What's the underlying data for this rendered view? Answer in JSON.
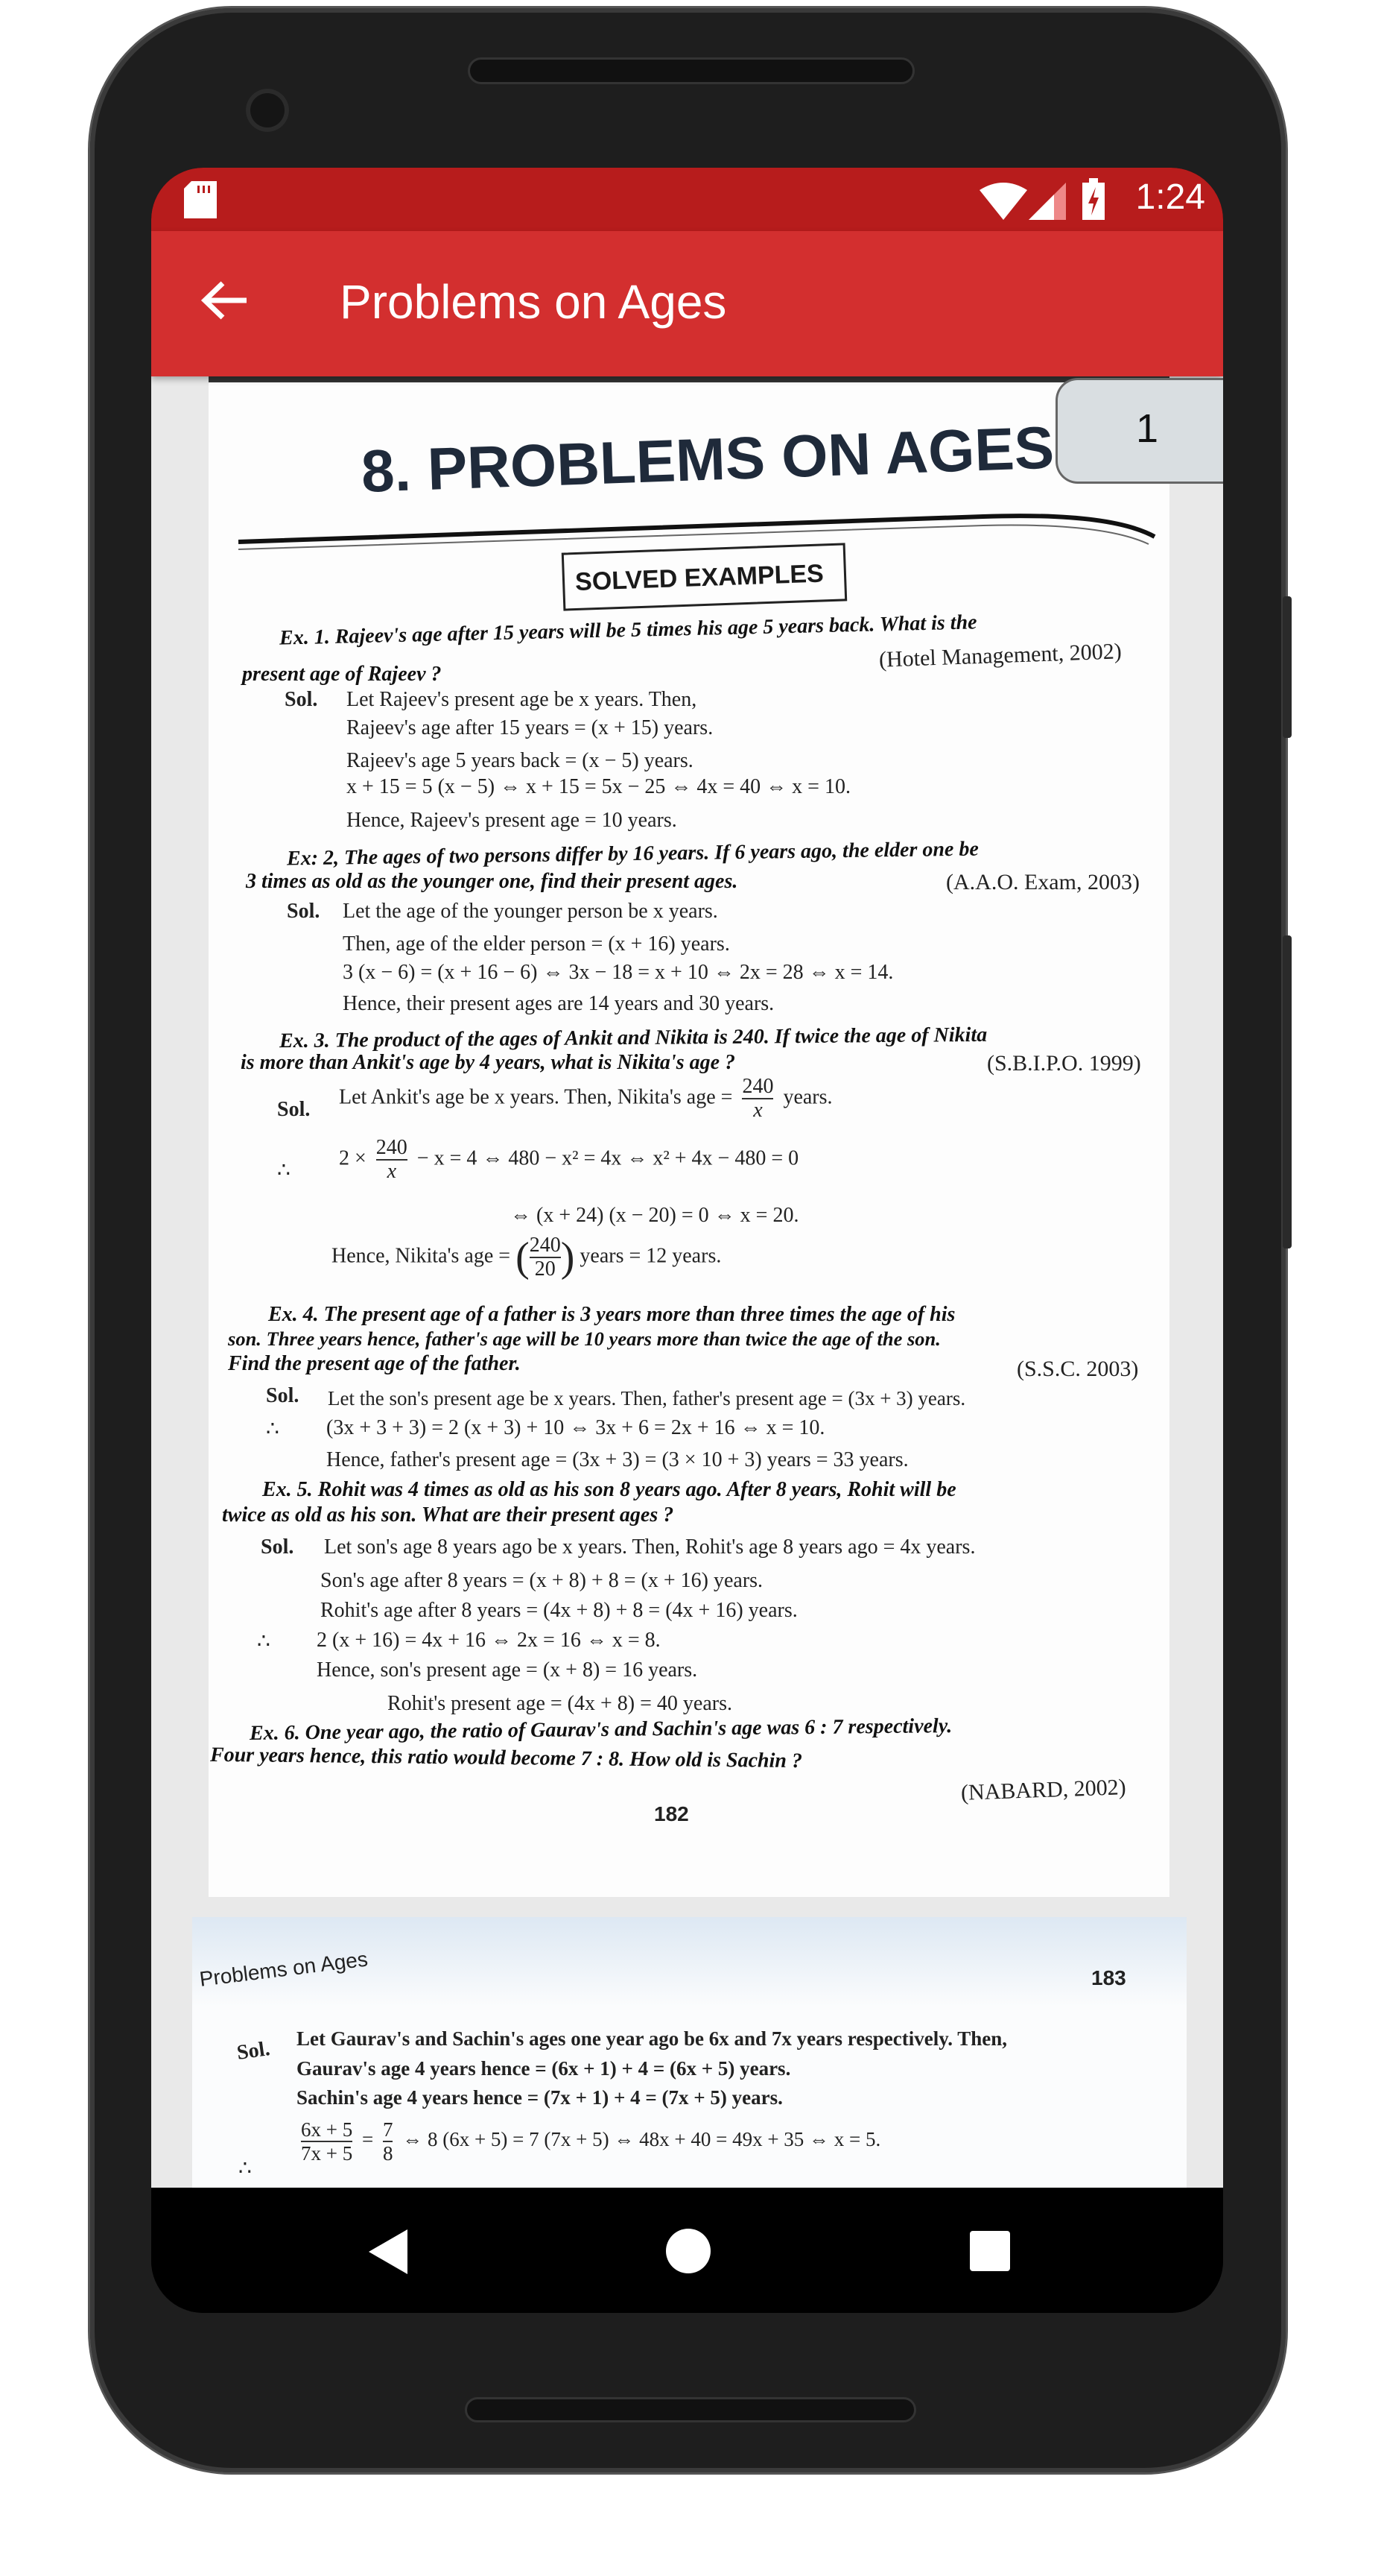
{
  "status_bar": {
    "time": "1:24",
    "icons": [
      "sd-card-icon",
      "wifi-icon",
      "signal-icon",
      "battery-charging-icon"
    ]
  },
  "app_bar": {
    "title": "Problems on Ages",
    "back_icon": "arrow-left-icon"
  },
  "page_indicator": "1",
  "colors": {
    "status_bar": "#b71c1c",
    "app_bar": "#d32f2f",
    "badge": "#d9dee1"
  },
  "page1": {
    "chapter_title": "8. PROBLEMS ON AGES",
    "section": "SOLVED EXAMPLES",
    "ex1": {
      "q1": "Ex. 1. Rajeev's age after 15 years will be 5 times his age 5 years back. What is the",
      "source": "(Hotel Management, 2002)",
      "q2": "present age of Rajeev ?",
      "sol_label": "Sol.",
      "s1": "Let Rajeev's present age be x years. Then,",
      "s2": "Rajeev's age after 15 years = (x + 15) years.",
      "s3": "Rajeev's age 5 years back = (x − 5) years.",
      "s4": "x + 15 = 5 (x − 5)  ⇔  x + 15 = 5x − 25  ⇔  4x = 40  ⇔  x = 10.",
      "s5": "Hence, Rajeev's present age = 10 years."
    },
    "ex2": {
      "q1": "Ex: 2, The ages of two persons differ by 16 years. If 6 years ago, the elder one be",
      "q2": "3 times as old as the younger one, find their present ages.",
      "source": "(A.A.O. Exam, 2003)",
      "sol_label": "Sol.",
      "s1": "Let the age of the younger person be x years.",
      "s2": "Then, age of the elder person = (x + 16) years.",
      "s3": "3 (x − 6) = (x + 16 − 6)  ⇔  3x − 18 = x + 10  ⇔  2x = 28  ⇔  x = 14.",
      "s4": "Hence, their present ages are 14 years and 30 years."
    },
    "ex3": {
      "q1": "Ex. 3. The product of the ages of Ankit and Nikita is 240. If twice the age of Nikita",
      "q2": "is more than Ankit's age by 4 years, what is Nikita's age ?",
      "source": "(S.B.I.P.O. 1999)",
      "sol_label": "Sol.",
      "s1a": "Let Ankit's age be x years. Then, Nikita's age =",
      "s1_num": "240",
      "s1_den": "x",
      "s1b": "years.",
      "therefore": "∴",
      "s2a": "2 ×",
      "s2_num": "240",
      "s2_den": "x",
      "s2b": "− x = 4  ⇔  480 − x² = 4x  ⇔  x² + 4x − 480 = 0",
      "s3": "⇔  (x + 24) (x − 20) = 0  ⇔  x = 20.",
      "s4a": "Hence, Nikita's age =",
      "s4_num": "240",
      "s4_den": "20",
      "s4b": "years = 12 years."
    },
    "ex4": {
      "q1": "Ex. 4. The present age of a father is 3 years more than three times the age of his",
      "q2": "son. Three years hence, father's age will be 10 years more than twice the age of the son.",
      "q3": "Find the present age of the father.",
      "source": "(S.S.C. 2003)",
      "sol_label": "Sol.",
      "s1": "Let the son's present age be x years. Then, father's present age = (3x + 3) years.",
      "therefore": "∴",
      "s2": "(3x + 3 + 3) = 2 (x + 3) + 10  ⇔  3x + 6 = 2x + 16  ⇔  x = 10.",
      "s3": "Hence, father's present age = (3x + 3) = (3 × 10 + 3) years = 33 years."
    },
    "ex5": {
      "q1": "Ex. 5. Rohit was 4 times as old as his son 8 years ago. After 8 years, Rohit will be",
      "q2": "twice as old as his son. What are their present ages ?",
      "sol_label": "Sol.",
      "s1": "Let son's age 8 years ago be x years. Then, Rohit's age 8 years ago = 4x years.",
      "s2": "Son's age after 8 years = (x + 8) + 8 = (x + 16) years.",
      "s3": "Rohit's age after 8 years = (4x + 8) + 8 = (4x + 16) years.",
      "therefore": "∴",
      "s4": "2 (x + 16) = 4x + 16  ⇔  2x = 16  ⇔  x = 8.",
      "s5": "Hence, son's present age = (x + 8) = 16 years.",
      "s6": "Rohit's present age = (4x + 8) = 40 years."
    },
    "ex6": {
      "q1": "Ex. 6. One year ago, the ratio of Gaurav's and Sachin's age was 6 : 7 respectively.",
      "q2": "Four years hence, this ratio would become 7 : 8. How old is Sachin ?",
      "source": "(NABARD, 2002)"
    },
    "page_number": "182"
  },
  "page2": {
    "running_header": "Problems on Ages",
    "page_number": "183",
    "sol_label": "Sol.",
    "s1": "Let Gaurav's and Sachin's ages one year ago be 6x and 7x years respectively. Then,",
    "s2": "Gaurav's age 4 years hence = (6x + 1) + 4 = (6x + 5) years.",
    "s3": "Sachin's age 4 years hence = (7x + 1) + 4 = (7x + 5) years.",
    "therefore": "∴",
    "s4_num": "6x + 5",
    "s4_den": "7x + 5",
    "s4_eq": "=",
    "s4_rnum": "7",
    "s4_rden": "8",
    "s4b": "⇔  8 (6x + 5) = 7 (7x + 5)  ⇔  48x + 40 = 49x + 35  ⇔  x = 5."
  },
  "nav_bar": {
    "icons": [
      "back-triangle-icon",
      "home-circle-icon",
      "recents-square-icon"
    ]
  }
}
